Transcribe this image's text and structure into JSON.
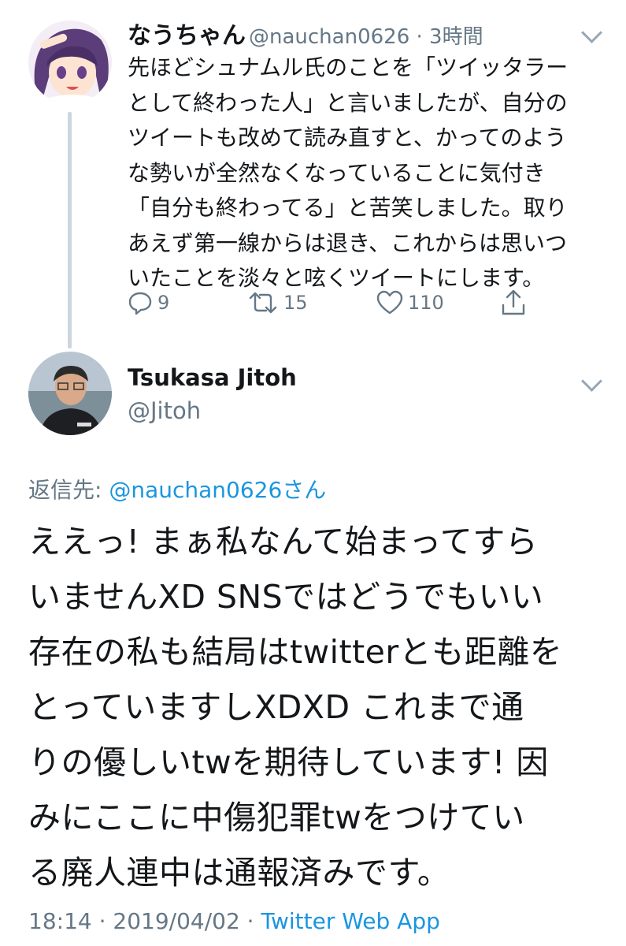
{
  "parent_tweet": {
    "display_name": "なうちゃん",
    "handle_time": "@nauchan0626 · 3時間",
    "text_lines": [
      "先ほどシュナムル氏のことを「ツイッタラー",
      "として終わった人」と言いましたが、自分の",
      "ツイートも改めて読み直すと、かってのよう",
      "な勢いが全然なくなっていることに気付き",
      "「自分も終わってる」と苦笑しました。取り",
      "あえず第一線からは退き、これからは思いつ",
      "いたことを淡々と呟くツイートにします。"
    ],
    "reply_count": "9",
    "retweet_count": "15",
    "like_count": "110"
  },
  "reply_tweet": {
    "display_name": "Tsukasa Jitoh",
    "handle": "@Jitoh",
    "replying_label": "返信先: ",
    "replying_to": "@nauchan0626さん",
    "text_lines": [
      "ええっ! まぁ私なんて始まってすら",
      "いませんXD SNSではどうでもいい",
      "存在の私も結局はtwitterとも距離を",
      "とっていますしXDXD これまで通",
      "りの優しいtwを期待しています! 因",
      "みにここに中傷犯罪twをつけてい",
      "る廃人連中は通報済みです。"
    ],
    "time_date": "18:14 · 2019/04/02 · ",
    "app": "Twitter Web App"
  },
  "colors": {
    "text": "#14171a",
    "secondary": "#657786",
    "link": "#1b95e0",
    "thread_line": "#cdd6dd"
  },
  "icons": [
    "chevron-down-icon",
    "reply-icon",
    "retweet-icon",
    "like-icon",
    "share-icon"
  ]
}
